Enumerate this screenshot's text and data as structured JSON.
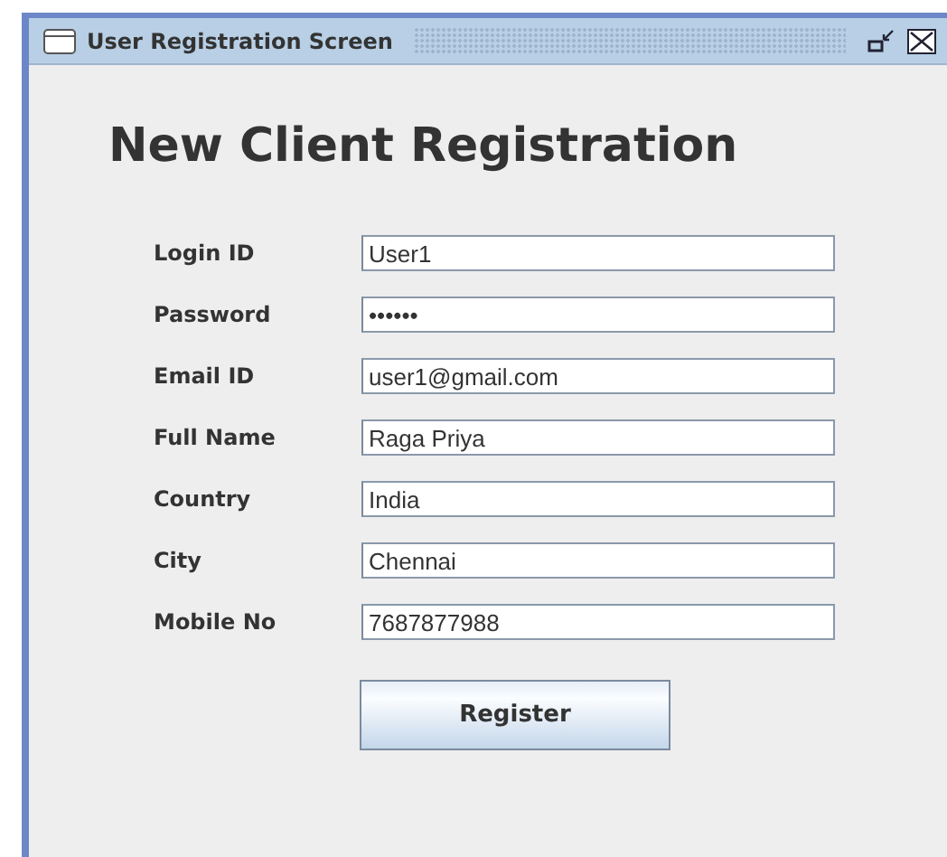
{
  "window": {
    "title": "User Registration Screen"
  },
  "heading": "New Client Registration",
  "fields": [
    {
      "label": "Login ID",
      "value": "User1"
    },
    {
      "label": "Password",
      "value": "••••••"
    },
    {
      "label": "Email ID",
      "value": "user1@gmail.com"
    },
    {
      "label": "Full Name",
      "value": "Raga Priya"
    },
    {
      "label": "Country",
      "value": "India"
    },
    {
      "label": "City",
      "value": "Chennai"
    },
    {
      "label": "Mobile No",
      "value": "7687877988"
    }
  ],
  "buttons": [
    "Register"
  ]
}
